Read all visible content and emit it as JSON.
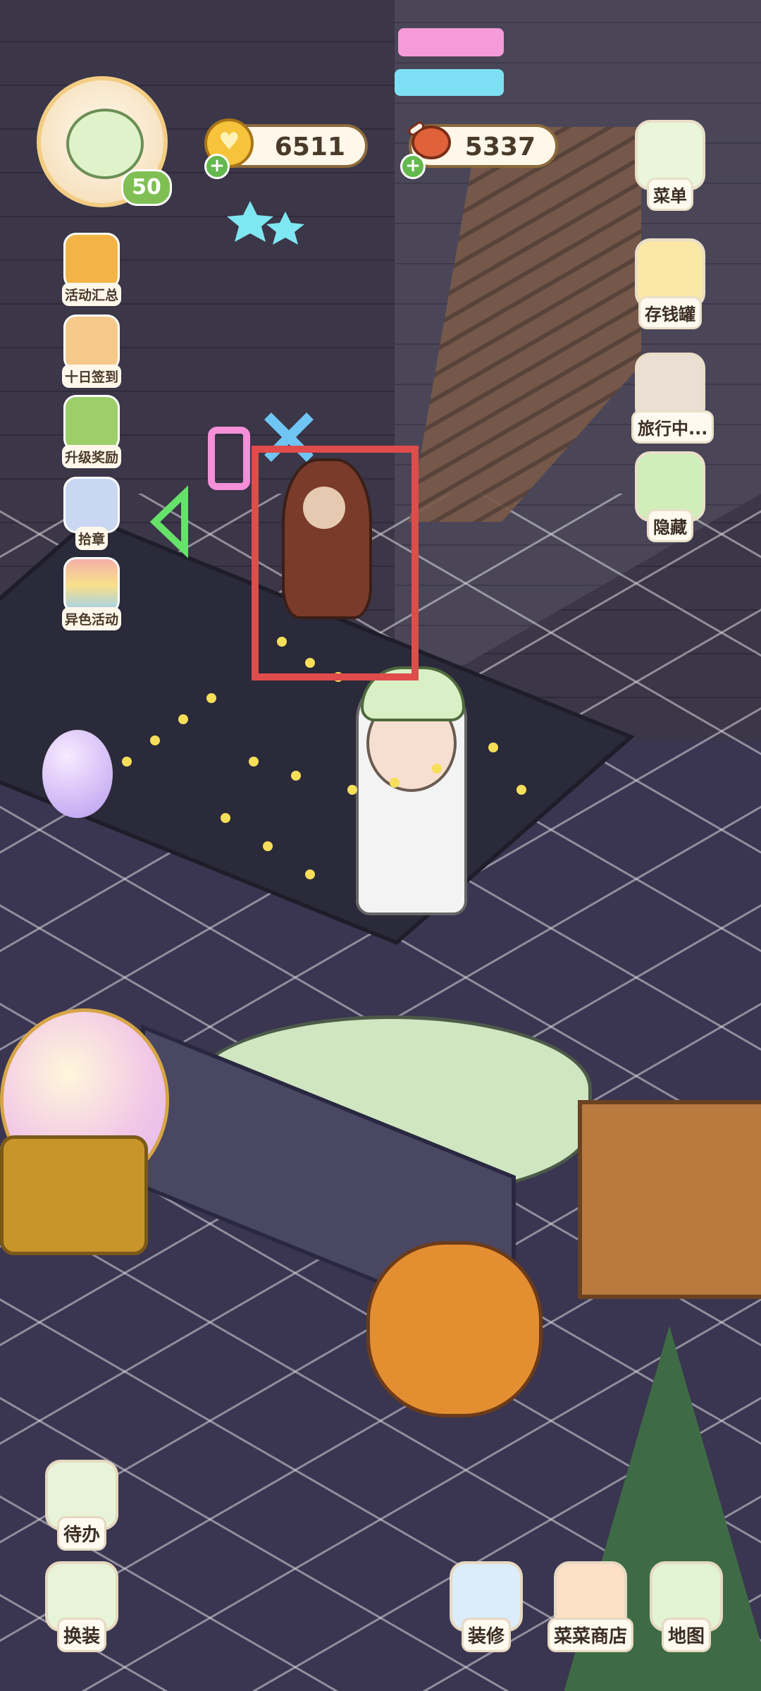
{
  "hud": {
    "player_level": "50",
    "currencies": [
      {
        "name": "coin",
        "icon": "heart-coin-icon",
        "value": "6511"
      },
      {
        "name": "food",
        "icon": "meat-icon",
        "value": "5337"
      }
    ]
  },
  "left_menu": [
    {
      "label": "活动汇总",
      "icon": "crown-house-icon",
      "color": "#f3b447"
    },
    {
      "label": "十日签到",
      "icon": "gift-calendar-icon",
      "color": "#f4c98a"
    },
    {
      "label": "升级奖励",
      "icon": "arrow-up-icon",
      "color": "#9ccf6a"
    },
    {
      "label": "拾章",
      "icon": "badge-stamp-icon",
      "color": "#c9d7f2"
    },
    {
      "label": "异色活动",
      "icon": "rainbow-icon",
      "color": "#f5b1a8"
    }
  ],
  "right_menu": [
    {
      "label": "菜单",
      "icon": "menu-list-icon",
      "color": "#7fc26b"
    },
    {
      "label": "存钱罐",
      "icon": "piggy-bank-icon",
      "color": "#f2c13f"
    },
    {
      "label": "旅行中...",
      "icon": "camera-icon",
      "color": "#6b5b4b"
    },
    {
      "label": "隐藏",
      "icon": "hide-frame-icon",
      "color": "#8fcf74"
    }
  ],
  "bottom_left": [
    {
      "label": "待办",
      "icon": "todo-list-icon",
      "color": "#9fd57a"
    },
    {
      "label": "换装",
      "icon": "outfit-change-icon",
      "color": "#9fd57a"
    }
  ],
  "bottom_right": [
    {
      "label": "装修",
      "icon": "decorate-icon",
      "color": "#9bc8ef"
    },
    {
      "label": "菜菜商店",
      "icon": "shop-icon",
      "color": "#f5a05a"
    },
    {
      "label": "地图",
      "icon": "map-icon",
      "color": "#8fcf74"
    }
  ],
  "scene": {
    "highlight_color": "#e04b4b"
  }
}
